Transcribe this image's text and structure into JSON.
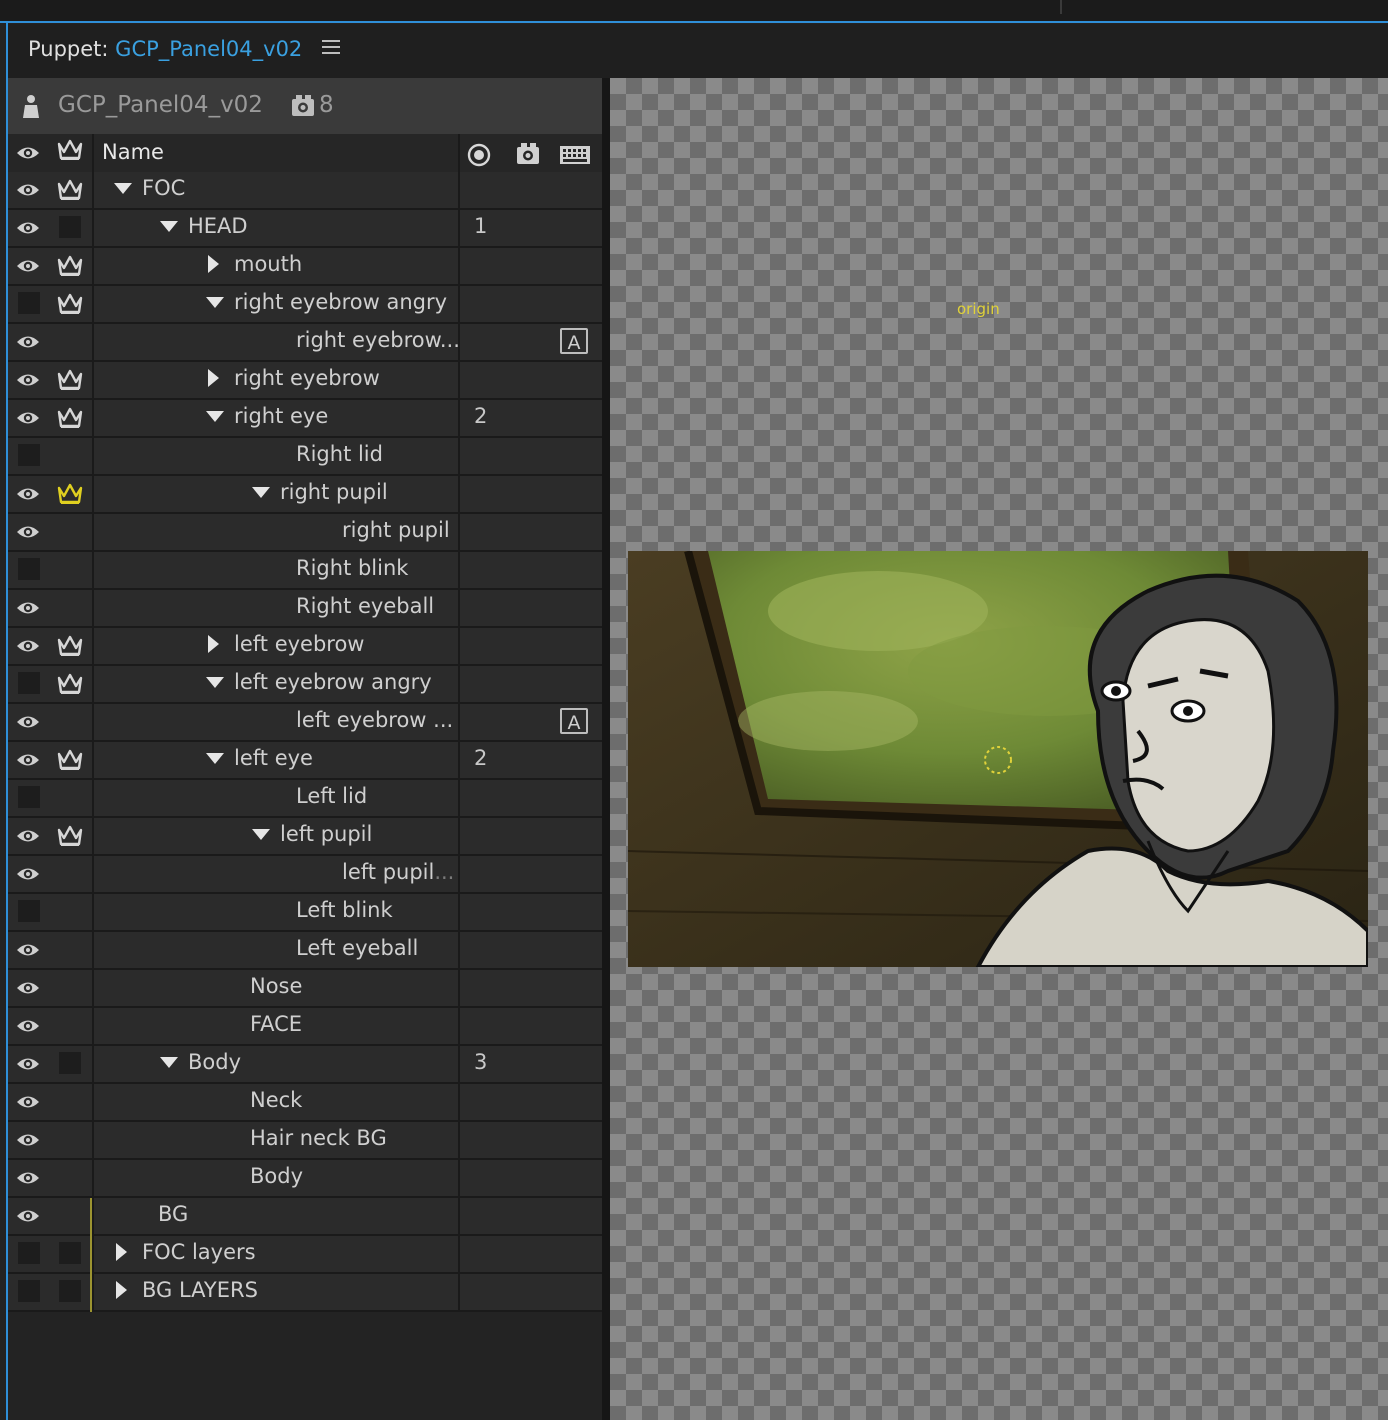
{
  "window": {
    "title_prefix": "Puppet: ",
    "title_link": "GCP_Panel04_v02"
  },
  "puppet": {
    "name": "GCP_Panel04_v02",
    "camera_count": "8"
  },
  "columns": {
    "name_header": "Name"
  },
  "rows": [
    {
      "label": "FOC",
      "indent": 0,
      "twirl": "down",
      "eye": true,
      "crown": "white",
      "num": "",
      "badge": ""
    },
    {
      "label": "HEAD",
      "indent": 1,
      "twirl": "down",
      "eye": true,
      "crown": "box",
      "num": "1",
      "badge": ""
    },
    {
      "label": "mouth",
      "indent": 2,
      "twirl": "right",
      "eye": true,
      "crown": "white",
      "num": "",
      "badge": ""
    },
    {
      "label": "right eyebrow angry",
      "indent": 2,
      "twirl": "down",
      "eye": false,
      "crown": "white",
      "num": "",
      "badge": ""
    },
    {
      "label": "right eyebrow...",
      "indent": 3,
      "twirl": "",
      "eye": true,
      "crown": "",
      "num": "",
      "badge": "A"
    },
    {
      "label": "right eyebrow",
      "indent": 2,
      "twirl": "right",
      "eye": true,
      "crown": "white",
      "num": "",
      "badge": ""
    },
    {
      "label": "right eye",
      "indent": 2,
      "twirl": "down",
      "eye": true,
      "crown": "white",
      "num": "2",
      "badge": ""
    },
    {
      "label": "Right lid",
      "indent": 3,
      "twirl": "",
      "eye": false,
      "crown": "",
      "num": "",
      "badge": ""
    },
    {
      "label": "right pupil",
      "indent": 3,
      "twirl": "down",
      "eye": true,
      "crown": "yellow",
      "num": "",
      "badge": ""
    },
    {
      "label": "right pupil",
      "indent": 4,
      "twirl": "",
      "eye": true,
      "crown": "",
      "num": "",
      "badge": ""
    },
    {
      "label": "Right blink",
      "indent": 3,
      "twirl": "",
      "eye": false,
      "crown": "",
      "num": "",
      "badge": ""
    },
    {
      "label": "Right eyeball",
      "indent": 3,
      "twirl": "",
      "eye": true,
      "crown": "",
      "num": "",
      "badge": ""
    },
    {
      "label": "left eyebrow",
      "indent": 2,
      "twirl": "right",
      "eye": true,
      "crown": "white",
      "num": "",
      "badge": ""
    },
    {
      "label": "left eyebrow angry",
      "indent": 2,
      "twirl": "down",
      "eye": false,
      "crown": "white",
      "num": "",
      "badge": ""
    },
    {
      "label": "left eyebrow ...",
      "indent": 3,
      "twirl": "",
      "eye": true,
      "crown": "",
      "num": "",
      "badge": "A"
    },
    {
      "label": "left eye",
      "indent": 2,
      "twirl": "down",
      "eye": true,
      "crown": "white",
      "num": "2",
      "badge": ""
    },
    {
      "label": "Left lid",
      "indent": 3,
      "twirl": "",
      "eye": false,
      "crown": "",
      "num": "",
      "badge": ""
    },
    {
      "label": "left pupil",
      "indent": 3,
      "twirl": "down",
      "eye": true,
      "crown": "white",
      "num": "",
      "badge": ""
    },
    {
      "label": "left pupil",
      "suffix": "...",
      "indent": 4,
      "twirl": "",
      "eye": true,
      "crown": "",
      "num": "",
      "badge": ""
    },
    {
      "label": "Left blink",
      "indent": 3,
      "twirl": "",
      "eye": false,
      "crown": "",
      "num": "",
      "badge": ""
    },
    {
      "label": "Left eyeball",
      "indent": 3,
      "twirl": "",
      "eye": true,
      "crown": "",
      "num": "",
      "badge": ""
    },
    {
      "label": "Nose",
      "indent": 2,
      "twirl": "",
      "eye": true,
      "crown": "",
      "num": "",
      "badge": ""
    },
    {
      "label": "FACE",
      "indent": 2,
      "twirl": "",
      "eye": true,
      "crown": "",
      "num": "",
      "badge": ""
    },
    {
      "label": "Body",
      "indent": 1,
      "twirl": "down",
      "eye": true,
      "crown": "box",
      "num": "3",
      "badge": ""
    },
    {
      "label": "Neck",
      "indent": 2,
      "twirl": "",
      "eye": true,
      "crown": "",
      "num": "",
      "badge": ""
    },
    {
      "label": "Hair neck BG",
      "indent": 2,
      "twirl": "",
      "eye": true,
      "crown": "",
      "num": "",
      "badge": ""
    },
    {
      "label": "Body",
      "indent": 2,
      "twirl": "",
      "eye": true,
      "crown": "",
      "num": "",
      "badge": ""
    },
    {
      "label": "BG",
      "indent": 0,
      "twirl": "",
      "eye": true,
      "crown": "",
      "num": "",
      "badge": "",
      "ybar": true
    },
    {
      "label": "FOC layers",
      "indent": 0,
      "twirl": "right",
      "eye": false,
      "crown": "box",
      "num": "",
      "badge": "",
      "ybar": true
    },
    {
      "label": "BG LAYERS",
      "indent": 0,
      "twirl": "right",
      "eye": false,
      "crown": "box",
      "num": "",
      "badge": "",
      "ybar": true
    }
  ],
  "viewer": {
    "origin_label": "origin"
  },
  "colors": {
    "accent_blue": "#3aa0e0",
    "selected_crown": "#e0d020",
    "parent_bar": "#9c9430"
  }
}
